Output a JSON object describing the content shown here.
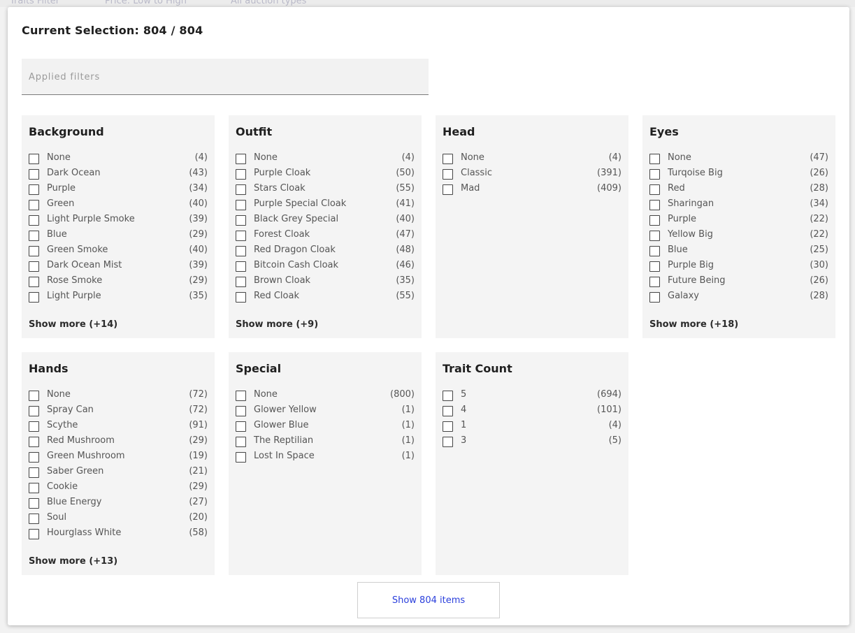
{
  "backdrop": {
    "traits": "Traits Filter",
    "sort": "Price: Low to High",
    "auction": "All auction types"
  },
  "title": "Current Selection: 804 / 804",
  "applied_filters_placeholder": "Applied filters",
  "panels": {
    "background": {
      "title": "Background",
      "items": [
        {
          "label": "None",
          "count": "(4)"
        },
        {
          "label": "Dark Ocean",
          "count": "(43)"
        },
        {
          "label": "Purple",
          "count": "(34)"
        },
        {
          "label": "Green",
          "count": "(40)"
        },
        {
          "label": "Light Purple Smoke",
          "count": "(39)"
        },
        {
          "label": "Blue",
          "count": "(29)"
        },
        {
          "label": "Green Smoke",
          "count": "(40)"
        },
        {
          "label": "Dark Ocean Mist",
          "count": "(39)"
        },
        {
          "label": "Rose Smoke",
          "count": "(29)"
        },
        {
          "label": "Light Purple",
          "count": "(35)"
        }
      ],
      "show_more": "Show more (+14)"
    },
    "outfit": {
      "title": "Outfit",
      "items": [
        {
          "label": "None",
          "count": "(4)"
        },
        {
          "label": "Purple Cloak",
          "count": "(50)"
        },
        {
          "label": "Stars Cloak",
          "count": "(55)"
        },
        {
          "label": "Purple Special Cloak",
          "count": "(41)"
        },
        {
          "label": "Black Grey Special",
          "count": "(40)"
        },
        {
          "label": "Forest Cloak",
          "count": "(47)"
        },
        {
          "label": "Red Dragon Cloak",
          "count": "(48)"
        },
        {
          "label": "Bitcoin Cash Cloak",
          "count": "(46)"
        },
        {
          "label": "Brown Cloak",
          "count": "(35)"
        },
        {
          "label": "Red Cloak",
          "count": "(55)"
        }
      ],
      "show_more": "Show more (+9)"
    },
    "head": {
      "title": "Head",
      "items": [
        {
          "label": "None",
          "count": "(4)"
        },
        {
          "label": "Classic",
          "count": "(391)"
        },
        {
          "label": "Mad",
          "count": "(409)"
        }
      ]
    },
    "eyes": {
      "title": "Eyes",
      "items": [
        {
          "label": "None",
          "count": "(47)"
        },
        {
          "label": "Turqoise Big",
          "count": "(26)"
        },
        {
          "label": "Red",
          "count": "(28)"
        },
        {
          "label": "Sharingan",
          "count": "(34)"
        },
        {
          "label": "Purple",
          "count": "(22)"
        },
        {
          "label": "Yellow Big",
          "count": "(22)"
        },
        {
          "label": "Blue",
          "count": "(25)"
        },
        {
          "label": "Purple Big",
          "count": "(30)"
        },
        {
          "label": "Future Being",
          "count": "(26)"
        },
        {
          "label": "Galaxy",
          "count": "(28)"
        }
      ],
      "show_more": "Show more (+18)"
    },
    "hands": {
      "title": "Hands",
      "items": [
        {
          "label": "None",
          "count": "(72)"
        },
        {
          "label": "Spray Can",
          "count": "(72)"
        },
        {
          "label": "Scythe",
          "count": "(91)"
        },
        {
          "label": "Red Mushroom",
          "count": "(29)"
        },
        {
          "label": "Green Mushroom",
          "count": "(19)"
        },
        {
          "label": "Saber Green",
          "count": "(21)"
        },
        {
          "label": "Cookie",
          "count": "(29)"
        },
        {
          "label": "Blue Energy",
          "count": "(27)"
        },
        {
          "label": "Soul",
          "count": "(20)"
        },
        {
          "label": "Hourglass White",
          "count": "(58)"
        }
      ],
      "show_more": "Show more (+13)"
    },
    "special": {
      "title": "Special",
      "items": [
        {
          "label": "None",
          "count": "(800)"
        },
        {
          "label": "Glower Yellow",
          "count": "(1)"
        },
        {
          "label": "Glower Blue",
          "count": "(1)"
        },
        {
          "label": "The Reptilian",
          "count": "(1)"
        },
        {
          "label": "Lost In Space",
          "count": "(1)"
        }
      ]
    },
    "trait_count": {
      "title": "Trait Count",
      "items": [
        {
          "label": "5",
          "count": "(694)"
        },
        {
          "label": "4",
          "count": "(101)"
        },
        {
          "label": "1",
          "count": "(4)"
        },
        {
          "label": "3",
          "count": "(5)"
        }
      ]
    }
  },
  "show_items_button": "Show 804 items",
  "colors": {
    "accent": "#2a3fdc",
    "panel_bg": "#f4f4f4",
    "input_bg": "#f2f2f2"
  }
}
